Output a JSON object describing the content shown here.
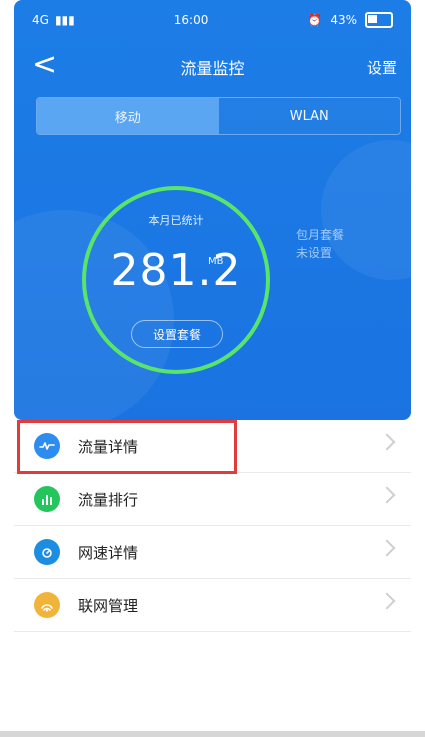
{
  "status": {
    "network": "4G",
    "time": "16:00",
    "battery_text": "43%"
  },
  "header": {
    "back_glyph": "<",
    "title": "流量监控",
    "settings_label": "设置"
  },
  "tabs": [
    {
      "label": "移动",
      "active": true
    },
    {
      "label": "WLAN",
      "active": false
    }
  ],
  "gauge": {
    "caption": "本月已统计",
    "value": "281.2",
    "unit": "MB",
    "button_label": "设置套餐",
    "ring_color": "#59e46b"
  },
  "plan_note": {
    "line1": "包月套餐",
    "line2": "未设置"
  },
  "menu": {
    "items": [
      {
        "label": "流量详情",
        "icon": "wave-icon",
        "icon_color": "#2d8cf0"
      },
      {
        "label": "流量排行",
        "icon": "bars-icon",
        "icon_color": "#25c55d"
      },
      {
        "label": "网速详情",
        "icon": "speed-icon",
        "icon_color": "#1c8de0"
      },
      {
        "label": "联网管理",
        "icon": "network-icon",
        "icon_color": "#f1b43a"
      }
    ]
  },
  "colors": {
    "hero_blue": "#1a73e1",
    "highlight_red": "#e13b3b"
  }
}
